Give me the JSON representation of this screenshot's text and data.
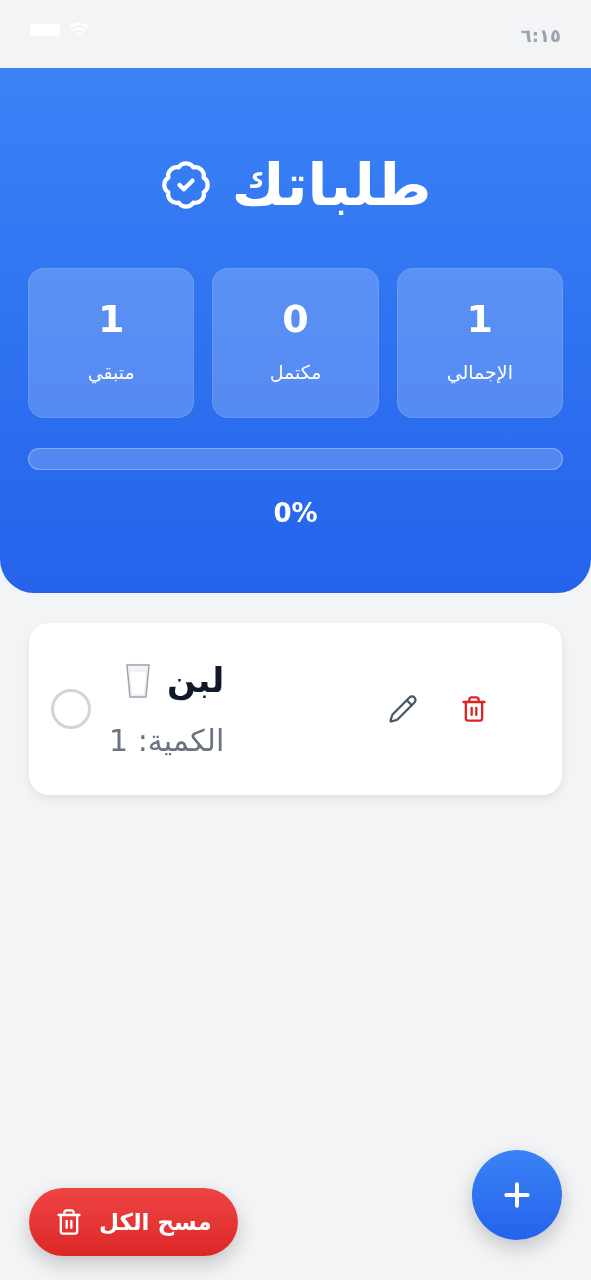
{
  "status_bar": {
    "time": "٦:١٥"
  },
  "header": {
    "title": "طلباتك"
  },
  "stats": [
    {
      "value": "1",
      "label": "الإجمالي"
    },
    {
      "value": "0",
      "label": "مكتمل"
    },
    {
      "value": "1",
      "label": "متبقي"
    }
  ],
  "progress": {
    "level": 0,
    "reading": "0%"
  },
  "items": [
    {
      "name": "لبن",
      "quantity": "الكمية: 1",
      "checked": false
    }
  ],
  "clear_all_button": "مسح الكل"
}
